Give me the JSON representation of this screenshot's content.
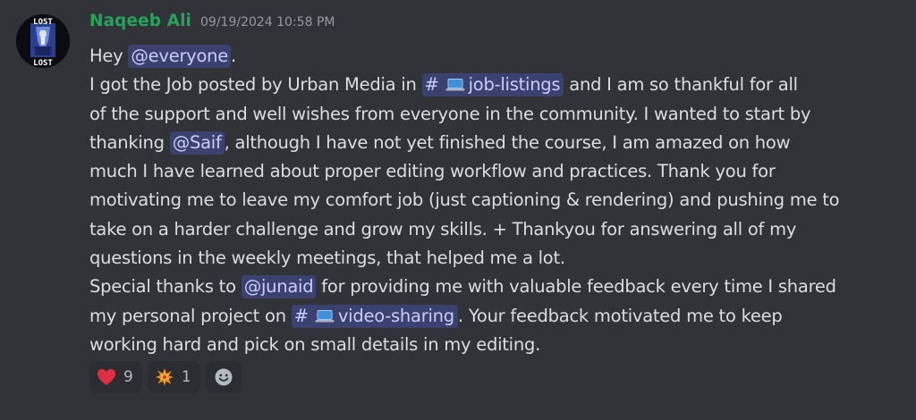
{
  "author": {
    "name": "Naqeeb Ali",
    "name_color": "#23a55a",
    "timestamp": "09/19/2024 10:58 PM",
    "avatar_icon": "lost-logo-avatar",
    "avatar_text": "LOST"
  },
  "message": {
    "l1": {
      "a": "Hey ",
      "m1": "@everyone",
      "b": "."
    },
    "l2": {
      "a": "I got the Job posted by Urban Media in ",
      "hash": "#",
      "channel": "job-listings",
      "b": " and I am so thankful for all"
    },
    "l3": "of the support and well wishes from everyone in the community. I wanted to start by",
    "l4": {
      "a": "thanking ",
      "m1": "@Saif",
      "b": ", although I have not yet finished the course, I am amazed on how"
    },
    "l5": "much I have learned about proper editing workflow and practices. Thank you for",
    "l6": "motivating me to leave my comfort job (just captioning & rendering) and pushing me to",
    "l7": "take on a harder challenge and grow my skills. + Thankyou for answering all of my",
    "l8": "questions in the weekly meetings, that helped me a lot.",
    "l9": {
      "a": "Special thanks to ",
      "m1": "@junaid",
      "b": " for providing me with valuable feedback every time I shared"
    },
    "l10": {
      "a": "my personal project on ",
      "hash": "#",
      "channel": "video-sharing",
      "b": ". Your feedback motivated me to keep"
    },
    "l11": "working hard and pick on small details in my editing."
  },
  "reactions": [
    {
      "icon": "red-heart-icon",
      "count": "9"
    },
    {
      "icon": "collision-icon",
      "count": "1"
    }
  ],
  "colors": {
    "background": "#313338",
    "mention_bg": "#3c4270",
    "mention_text": "#c9cdfb",
    "text": "#dbdee1",
    "reaction_bg": "#2b2d31"
  }
}
